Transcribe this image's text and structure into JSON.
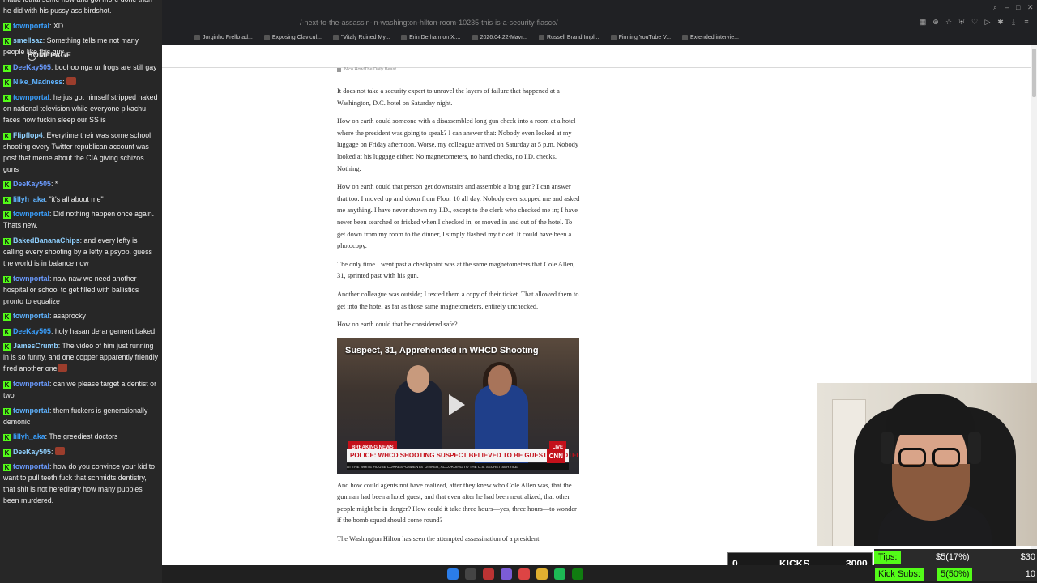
{
  "browser": {
    "url": "/-next-to-the-assassin-in-washington-hilton-room-10235-this-is-a-security-fiasco/",
    "bookmarks": [
      "Jorginho Frello ad...",
      "Exposing Clavicul...",
      "\"Vitaly Ruined My...",
      "Erin Derham on X:...",
      "2026.04.22-Mavr...",
      "Russell Brand Impl...",
      "Firming YouTube V...",
      "Extended intervie..."
    ]
  },
  "chat": {
    "homepage_label": "HOMEPAGE",
    "messages": [
      {
        "user": "",
        "text": "made lethal some how and got more done than he did with his pussy ass birdshot.",
        "badge": false
      },
      {
        "user": "townportal",
        "text": "XD",
        "badge": true
      },
      {
        "user": "smellsaz",
        "text": "Something tells me not many people like this guy",
        "badge": true
      },
      {
        "user": "DeeKay505",
        "text": "boohoo nga ur frogs are still gay",
        "badge": true
      },
      {
        "user": "Nike_Madness",
        "text": "",
        "badge": true,
        "emote": true
      },
      {
        "user": "townportal",
        "text": "he jus got himself stripped naked on national television while everyone pikachu faces how fuckin sleep our SS is",
        "badge": true
      },
      {
        "user": "Flipflop4",
        "text": "Everytime their was some school shooting every Twitter republican account was post that meme about the CIA giving schizos guns",
        "badge": true
      },
      {
        "user": "DeeKay505",
        "text": "*",
        "badge": true
      },
      {
        "user": "lillyh_aka",
        "text": "\"it's all about me\"",
        "badge": true
      },
      {
        "user": "townportal",
        "text": "Did nothing happen once again. Thats new.",
        "badge": true
      },
      {
        "user": "BakedBananaChips",
        "text": "and every lefty is calling every shooting by a lefty a psyop. guess the world is in balance now",
        "badge": true
      },
      {
        "user": "townportal",
        "text": "naw naw we need another hospital or school to get filled with ballistics pronto to equalize",
        "badge": true
      },
      {
        "user": "townportal",
        "text": "asaprocky",
        "badge": true
      },
      {
        "user": "DeeKay505",
        "text": "holy hasan derangement baked",
        "badge": true
      },
      {
        "user": "JamesCrumb",
        "text": "The video of him just running in is so funny, and one copper apparently friendly fired another one",
        "badge": true,
        "emote": true
      },
      {
        "user": "townportal",
        "text": "can we please target a dentist or two",
        "badge": true
      },
      {
        "user": "townportal",
        "text": "them fuckers is generationally demonic",
        "badge": true
      },
      {
        "user": "lillyh_aka",
        "text": "The greediest doctors",
        "badge": true
      },
      {
        "user": "DeeKay505",
        "text": "",
        "badge": true,
        "emote": true
      },
      {
        "user": "townportal",
        "text": "how do you convince your kid to want to pull teeth fuck that schmidts dentistry, that shit is not hereditary how many puppies been murdered.",
        "badge": true
      }
    ]
  },
  "article": {
    "photo_credit": "Nico How/The Daily Beast",
    "paragraphs_top": [
      "It does not take a security expert to unravel the layers of failure that happened at a Washington, D.C. hotel on Saturday night.",
      "How on earth could someone with a disassembled long gun check into a room at a hotel where the president was going to speak? I can answer that: Nobody even looked at my luggage on Friday afternoon. Worse, my colleague arrived on Saturday at 5 p.m. Nobody looked at his luggage either: No magnetometers, no hand checks, no I.D. checks. Nothing.",
      "How on earth could that person get downstairs and assemble a long gun? I can answer that too. I moved up and down from Floor 10 all day. Nobody ever stopped me and asked me anything. I have never shown my I.D., except to the clerk who checked me in; I have never been searched or frisked when I checked in, or moved in and out of the hotel. To get down from my room to the dinner, I simply flashed my ticket. It could have been a photocopy.",
      "The only time I went past a checkpoint was at the same magnetometers that Cole Allen, 31, sprinted past with his gun.",
      "Another colleague was outside; I texted them a copy of their ticket. That allowed them to get into the hotel as far as those same magnetometers, entirely unchecked.",
      "How on earth could that be considered safe?"
    ],
    "video": {
      "title": "Suspect, 31, Apprehended in WHCD Shooting",
      "breaking": "BREAKING NEWS",
      "live": "LIVE",
      "headline": "POLICE: WHCD SHOOTING SUSPECT BELIEVED TO BE GUEST AT HOTEL",
      "network": "CNN",
      "ticker": "AT THE WHITE HOUSE CORRESPONDENTS' DINNER, ACCORDING TO THE U.S. SECRET SERVICE"
    },
    "paragraphs_bottom": [
      "And how could agents not have realized, after they knew who Cole Allen was, that the gunman had been a hotel guest, and that even after he had been neutralized, that other people might be in danger? How could it take three hours—yes, three hours—to wonder if the bomb squad should come round?",
      "The Washington Hilton has seen the attempted assassination of a president"
    ]
  },
  "overlay": {
    "kicks_current": "0",
    "kicks_label": "KICKS",
    "kicks_goal": "3000",
    "tips_label": "Tips:",
    "tips_value": "$5(17%)",
    "tips_goal": "$30",
    "subs_label": "Kick Subs:",
    "subs_value": "5(50%)",
    "subs_goal": "10"
  },
  "colors": {
    "kick_green": "#53fc18",
    "cnn_red": "#c4111b"
  }
}
